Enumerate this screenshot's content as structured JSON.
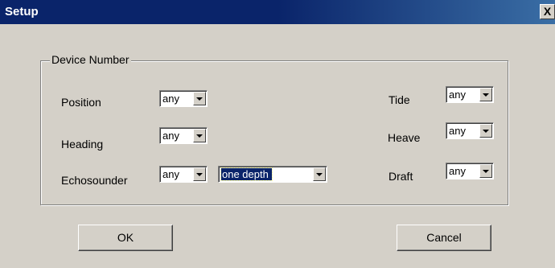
{
  "window": {
    "title": "Setup",
    "close_glyph": "X"
  },
  "group": {
    "legend": "Device Number"
  },
  "left_fields": [
    {
      "label": "Position",
      "value": "any"
    },
    {
      "label": "Heading",
      "value": "any"
    },
    {
      "label": "Echosounder",
      "value": "any"
    }
  ],
  "echosounder_mode": {
    "value": "one depth"
  },
  "right_fields": [
    {
      "label": "Tide",
      "value": "any"
    },
    {
      "label": "Heave",
      "value": "any"
    },
    {
      "label": "Draft",
      "value": "any"
    }
  ],
  "buttons": {
    "ok_label": "OK",
    "cancel_label": "Cancel"
  },
  "icons": {
    "dropdown": "chevron-down-icon",
    "close": "close-icon"
  },
  "colors": {
    "titlebar": "#0a246a",
    "face": "#d4d0c8",
    "selection": "#0a246a"
  }
}
